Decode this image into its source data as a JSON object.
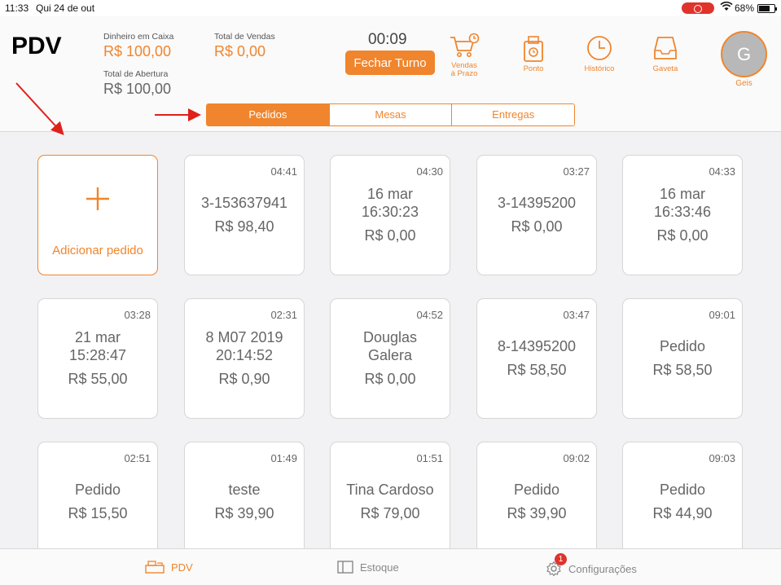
{
  "status_bar": {
    "time": "11:33",
    "date": "Qui 24 de out",
    "battery": "68%"
  },
  "header": {
    "title": "PDV",
    "cash_label": "Dinheiro em Caixa",
    "cash_value": "R$ 100,00",
    "sales_label": "Total de Vendas",
    "sales_value": "R$ 0,00",
    "opening_label": "Total de Abertura",
    "opening_value": "R$ 100,00",
    "timer": "00:09",
    "close_shift_label": "Fechar Turno",
    "icons": {
      "credit_sales": "Vendas\nà Prazo",
      "clock_in": "Ponto",
      "history": "Histórico",
      "drawer": "Gaveta"
    },
    "user_initial": "G",
    "user_name": "Geis"
  },
  "tabs": [
    {
      "label": "Pedidos",
      "active": true
    },
    {
      "label": "Mesas",
      "active": false
    },
    {
      "label": "Entregas",
      "active": false
    }
  ],
  "add_order_label": "Adicionar pedido",
  "orders": [
    {
      "time": "04:41",
      "name": "3-153637941",
      "value": "R$ 98,40"
    },
    {
      "time": "04:30",
      "name": "16 mar\n16:30:23",
      "value": "R$ 0,00"
    },
    {
      "time": "03:27",
      "name": "3-14395200",
      "value": "R$ 0,00"
    },
    {
      "time": "04:33",
      "name": "16 mar\n16:33:46",
      "value": "R$ 0,00"
    },
    {
      "time": "03:28",
      "name": "21 mar\n15:28:47",
      "value": "R$ 55,00"
    },
    {
      "time": "02:31",
      "name": "8 M07 2019\n20:14:52",
      "value": "R$ 0,90"
    },
    {
      "time": "04:52",
      "name": "Douglas\nGalera",
      "value": "R$ 0,00"
    },
    {
      "time": "03:47",
      "name": "8-14395200",
      "value": "R$ 58,50"
    },
    {
      "time": "09:01",
      "name": "Pedido",
      "value": "R$ 58,50"
    },
    {
      "time": "02:51",
      "name": "Pedido",
      "value": "R$ 15,50"
    },
    {
      "time": "01:49",
      "name": "teste",
      "value": "R$ 39,90"
    },
    {
      "time": "01:51",
      "name": "Tina Cardoso",
      "value": "R$ 79,00"
    },
    {
      "time": "09:02",
      "name": "Pedido",
      "value": "R$ 39,90"
    },
    {
      "time": "09:03",
      "name": "Pedido",
      "value": "R$ 44,90"
    }
  ],
  "bottom_nav": {
    "pdv": "PDV",
    "stock": "Estoque",
    "settings": "Configurações",
    "settings_badge": "1"
  },
  "colors": {
    "accent": "#f0852d",
    "badge": "#e0332b",
    "annotation_arrow": "#e0201a"
  }
}
